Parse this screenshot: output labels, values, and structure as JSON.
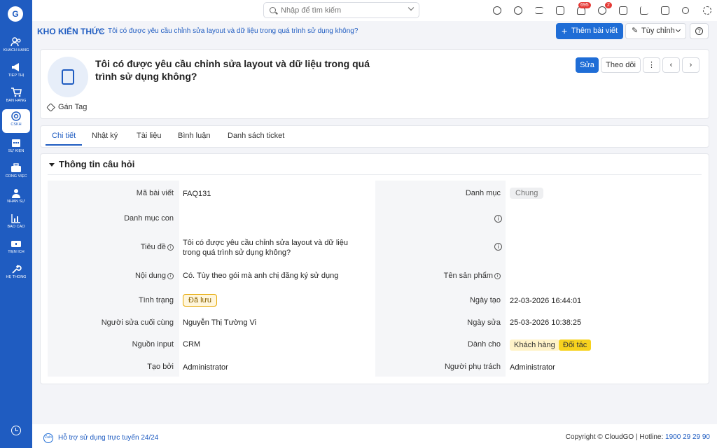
{
  "app": {
    "logo_text": "G"
  },
  "sidebar": {
    "items": [
      {
        "label": "KHÁCH HÀNG",
        "icon": "users-icon"
      },
      {
        "label": "TIẾP THỊ",
        "icon": "megaphone-icon"
      },
      {
        "label": "BÁN HÀNG",
        "icon": "cart-icon"
      },
      {
        "label": "CSKH",
        "icon": "support-icon"
      },
      {
        "label": "SỰ KIỆN",
        "icon": "calendar-icon"
      },
      {
        "label": "CÔNG VIỆC",
        "icon": "briefcase-icon"
      },
      {
        "label": "NHÂN SỰ",
        "icon": "person-icon"
      },
      {
        "label": "BÁO CÁO",
        "icon": "report-icon"
      },
      {
        "label": "TIỆN ÍCH",
        "icon": "utilities-icon"
      },
      {
        "label": "HỆ THỐNG",
        "icon": "wrench-icon"
      }
    ],
    "active_index": 3
  },
  "topbar": {
    "search_placeholder": "Nhập để tìm kiếm",
    "notifications_count": "695",
    "messages_count": "2"
  },
  "header": {
    "module_title": "KHO KIẾN THỨC",
    "separator": "›",
    "current_record": "Tôi có được yêu cầu chỉnh sửa layout và dữ liệu trong quá trình sử dụng không?",
    "add_button": "Thêm bài viết",
    "customize_button": "Tùy chỉnh"
  },
  "record": {
    "title": "Tôi có được yêu cầu chỉnh sửa layout và dữ liệu trong quá trình sử dụng không?",
    "tag_label": "Gán Tag",
    "edit_button": "Sửa",
    "follow_button": "Theo dõi"
  },
  "tabs": [
    {
      "label": "Chi tiết"
    },
    {
      "label": "Nhật ký"
    },
    {
      "label": "Tài liệu"
    },
    {
      "label": "Bình luận"
    },
    {
      "label": "Danh sách ticket"
    }
  ],
  "section": {
    "title": "Thông tin câu hỏi",
    "left": {
      "article_code_label": "Mã bài viết",
      "article_code": "FAQ131",
      "subcategory_label": "Danh mục con",
      "subcategory": "",
      "title_label": "Tiêu đề",
      "title": "Tôi có được yêu cầu chỉnh sửa layout và dữ liệu trong quá trình sử dụng không?",
      "content_label": "Nội dung",
      "content": "Có. Tùy theo gói mà anh chị đăng ký sử dụng",
      "status_label": "Tình trạng",
      "status": "Đã lưu",
      "last_editor_label": "Người sửa cuối cùng",
      "last_editor": "Nguyễn Thị Tường Vi",
      "input_source_label": "Nguồn input",
      "input_source": "CRM",
      "created_by_label": "Tạo bởi",
      "created_by": "Administrator"
    },
    "right": {
      "category_label": "Danh mục",
      "category": "Chung",
      "product_label": "Tên sản phẩm",
      "created_at_label": "Ngày tạo",
      "created_at": "22-03-2026 16:44:01",
      "modified_at_label": "Ngày sửa",
      "modified_at": "25-03-2026 10:38:25",
      "audience_label": "Dành cho",
      "audience": [
        "Khách hàng",
        "Đối tác"
      ],
      "assignee_label": "Người phụ trách",
      "assignee": "Administrator"
    }
  },
  "footer": {
    "support": "Hỗ trợ sử dụng trực tuyến 24/24",
    "copyright": "Copyright © CloudGO | Hotline:",
    "hotline": "1900 29 29 90"
  }
}
